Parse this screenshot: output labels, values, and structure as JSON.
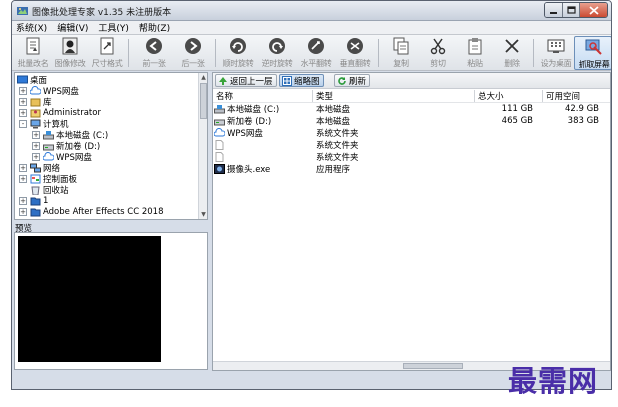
{
  "window": {
    "title": "图像批处理专家 v1.35 未注册版本"
  },
  "menu": [
    "系统(X)",
    "编辑(V)",
    "工具(Y)",
    "帮助(Z)"
  ],
  "toolbar": [
    {
      "label": "批量改名",
      "icon": "rename-icon",
      "enabled": false
    },
    {
      "label": "图像修改",
      "icon": "portrait-icon",
      "enabled": false
    },
    {
      "label": "尺寸格式",
      "icon": "resize-icon",
      "enabled": false
    },
    {
      "label": "前一张",
      "icon": "prev-icon",
      "enabled": false
    },
    {
      "label": "后一张",
      "icon": "next-icon",
      "enabled": false
    },
    {
      "label": "顺时旋转",
      "icon": "rotate-cw-icon",
      "enabled": false
    },
    {
      "label": "逆时旋转",
      "icon": "rotate-ccw-icon",
      "enabled": false
    },
    {
      "label": "水平翻转",
      "icon": "flip-h-icon",
      "enabled": false
    },
    {
      "label": "垂直翻转",
      "icon": "flip-v-icon",
      "enabled": false
    },
    {
      "label": "复制",
      "icon": "copy-icon",
      "enabled": false
    },
    {
      "label": "剪切",
      "icon": "scissors-icon",
      "enabled": false
    },
    {
      "label": "粘贴",
      "icon": "paste-icon",
      "enabled": false
    },
    {
      "label": "删除",
      "icon": "delete-icon",
      "enabled": false
    },
    {
      "label": "设为桌面",
      "icon": "wallpaper-icon",
      "enabled": false
    },
    {
      "label": "抓取屏幕",
      "icon": "capture-icon",
      "enabled": true
    }
  ],
  "tree": [
    {
      "label": "桌面",
      "icon": "desktop-icon",
      "expander": ""
    },
    {
      "label": "WPS网盘",
      "icon": "cloud-icon",
      "expander": "+"
    },
    {
      "label": "库",
      "icon": "library-icon",
      "expander": "+"
    },
    {
      "label": "Administrator",
      "icon": "user-icon",
      "expander": "+"
    },
    {
      "label": "计算机",
      "icon": "computer-icon",
      "expander": "-"
    },
    {
      "label": "本地磁盘 (C:)",
      "icon": "drive-c-icon",
      "expander": "+"
    },
    {
      "label": "新加卷 (D:)",
      "icon": "drive-icon",
      "expander": "+"
    },
    {
      "label": "WPS网盘",
      "icon": "cloud-icon",
      "expander": "+"
    },
    {
      "label": "网络",
      "icon": "network-icon",
      "expander": "+"
    },
    {
      "label": "控制面板",
      "icon": "control-panel-icon",
      "expander": "+"
    },
    {
      "label": "回收站",
      "icon": "recycle-bin-icon",
      "expander": ""
    },
    {
      "label": "1",
      "icon": "folder-icon",
      "expander": "+"
    },
    {
      "label": "Adobe After Effects CC 2018",
      "icon": "folder-icon",
      "expander": "+"
    }
  ],
  "preview": {
    "label": "预览"
  },
  "right_toolbar": {
    "up_label": "返回上一层",
    "thumb_label": "缩略图",
    "refresh_label": "刷新"
  },
  "columns": [
    "名称",
    "类型",
    "总大小",
    "可用空间"
  ],
  "files": [
    {
      "name": "本地磁盘 (C:)",
      "type": "本地磁盘",
      "total": "111 GB",
      "free": "42.9 GB",
      "icon": "drive-c-icon"
    },
    {
      "name": "新加卷 (D:)",
      "type": "本地磁盘",
      "total": "465 GB",
      "free": "383 GB",
      "icon": "drive-icon"
    },
    {
      "name": "WPS网盘",
      "type": "系统文件夹",
      "total": "",
      "free": "",
      "icon": "cloud-icon"
    },
    {
      "name": "",
      "type": "系统文件夹",
      "total": "",
      "free": "",
      "icon": "blank-file-icon"
    },
    {
      "name": "",
      "type": "系统文件夹",
      "total": "",
      "free": "",
      "icon": "blank-file-icon"
    },
    {
      "name": "摄像头.exe",
      "type": "应用程序",
      "total": "",
      "free": "",
      "icon": "camera-app-icon"
    }
  ],
  "watermark": "最需网",
  "colors": {
    "frame": "#d6dde8",
    "titlebar": "#c8d0dc",
    "close_button": "#c8442b",
    "selection": "#c5dbf2",
    "watermark": "#4a2ea8"
  }
}
